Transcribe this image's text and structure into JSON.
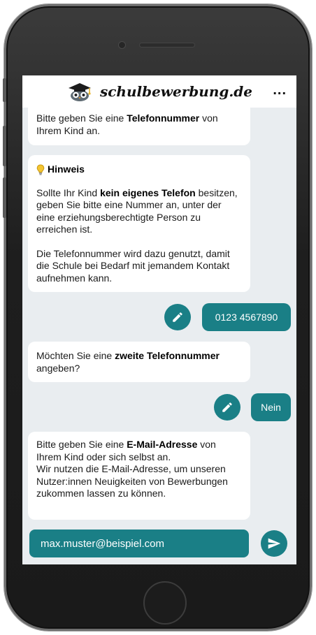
{
  "app": {
    "brand": "schulbewerbung.de",
    "menu_icon": "more-dots-icon",
    "menu_label": "..."
  },
  "colors": {
    "accent": "#1a7f86",
    "chat_background": "#e9edf0",
    "bubble": "#ffffff"
  },
  "messages": {
    "phone_prompt": {
      "pre": "Bitte geben Sie eine ",
      "bold": "Telefonnummer",
      "post": " von Ihrem Kind an."
    },
    "hint": {
      "icon": "lightbulb-icon",
      "title": "Hinweis",
      "p1_pre": "Sollte Ihr Kind ",
      "p1_bold": "kein eigenes Telefon",
      "p1_post": " besitzen, geben Sie bitte eine Nummer an, unter der eine erziehungsberechtigte Person zu erreichen ist.",
      "p2": "Die Telefonnummer wird dazu genutzt, damit die Schule bei Bedarf mit jemandem Kontakt aufnehmen kann."
    },
    "phone_answer": "0123 4567890",
    "second_phone_prompt": {
      "pre": "Möchten Sie eine ",
      "bold": "zweite Telefonnummer",
      "post": " angeben?"
    },
    "second_phone_answer": "Nein",
    "email_prompt": {
      "pre": "Bitte geben Sie eine ",
      "bold": "E-Mail-Adresse",
      "post": " von Ihrem Kind oder sich selbst an.",
      "line2": "Wir nutzen die E-Mail-Adresse, um unseren Nutzer:innen Neuigkeiten von Bewerbungen zukommen lassen zu können."
    }
  },
  "input": {
    "value": "max.muster@beispiel.com",
    "send_icon": "send-icon"
  },
  "icons": {
    "edit": "pencil-icon",
    "logo": "graduation-cap-owl-icon"
  }
}
